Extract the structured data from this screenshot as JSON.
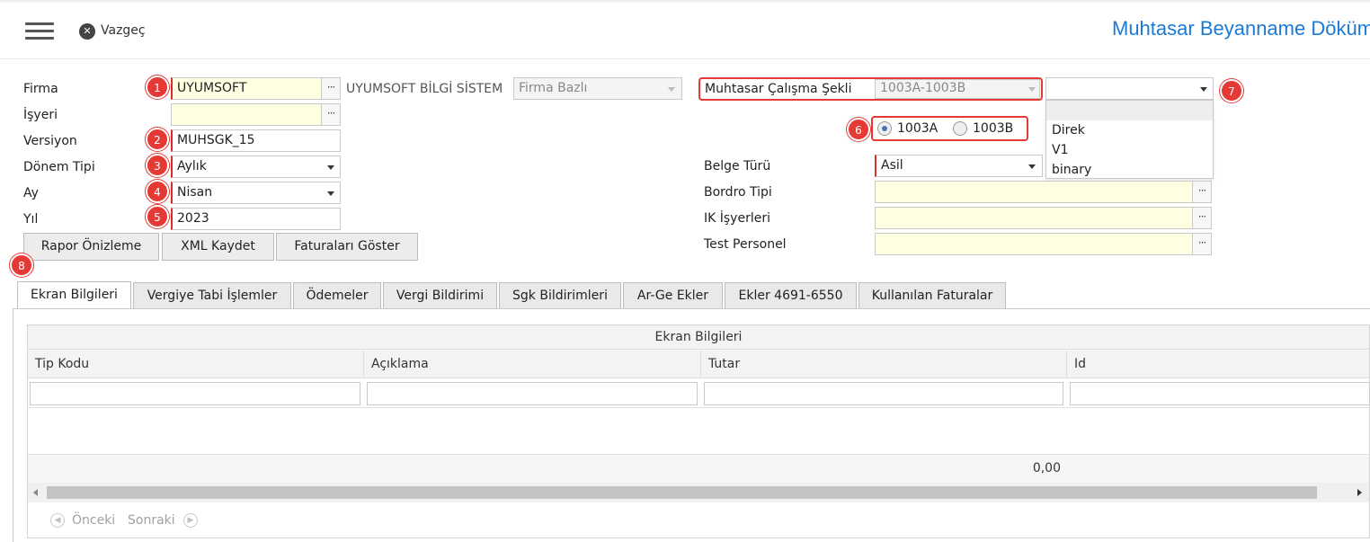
{
  "header": {
    "menu_icon": "hamburger-icon",
    "cancel_label": "Vazgeç",
    "page_title": "Muhtasar Beyanname Döküm"
  },
  "form": {
    "firma_label": "Firma",
    "firma_value": "UYUMSOFT",
    "firma_name": "UYUMSOFT BİLGİ SİSTEM",
    "firma_scope": "Firma Bazlı",
    "isyeri_label": "İşyeri",
    "isyeri_value": "",
    "versiyon_label": "Versiyon",
    "versiyon_value": "MUHSGK_15",
    "donem_tipi_label": "Dönem Tipi",
    "donem_tipi_value": "Aylık",
    "ay_label": "Ay",
    "ay_value": "Nisan",
    "yil_label": "Yıl",
    "yil_value": "2023",
    "muhtasar_label": "Muhtasar Çalışma Şekli",
    "muhtasar_value": "1003A-1003B",
    "extra_select_value": "",
    "radio_a": "1003A",
    "radio_b": "1003B",
    "belge_turu_label": "Belge Türü",
    "belge_turu_value": "Asil",
    "bordro_tipi_label": "Bordro Tipi",
    "ik_isyerleri_label": "IK İşyerleri",
    "test_personel_label": "Test Personel",
    "ellipsis": "···"
  },
  "dropdown_options": [
    "",
    "Direk",
    "V1",
    "binary"
  ],
  "buttons": {
    "rapor": "Rapor Önizleme",
    "xml": "XML Kaydet",
    "faturalar": "Faturaları Göster"
  },
  "badges": [
    "1",
    "2",
    "3",
    "4",
    "5",
    "6",
    "7",
    "8"
  ],
  "tabs": [
    "Ekran Bilgileri",
    "Vergiye Tabi İşlemler",
    "Ödemeler",
    "Vergi Bildirimi",
    "Sgk Bildirimleri",
    "Ar-Ge Ekler",
    "Ekler 4691-6550",
    "Kullanılan Faturalar"
  ],
  "grid": {
    "title": "Ekran Bilgileri",
    "columns": [
      "Tip Kodu",
      "Açıklama",
      "Tutar",
      "Id"
    ],
    "total": "0,00"
  },
  "pager": {
    "prev": "Önceki",
    "next": "Sonraki"
  },
  "colors": {
    "accent": "#1a7ad4",
    "badge": "#e53935",
    "required_field": "#ffffe1"
  }
}
